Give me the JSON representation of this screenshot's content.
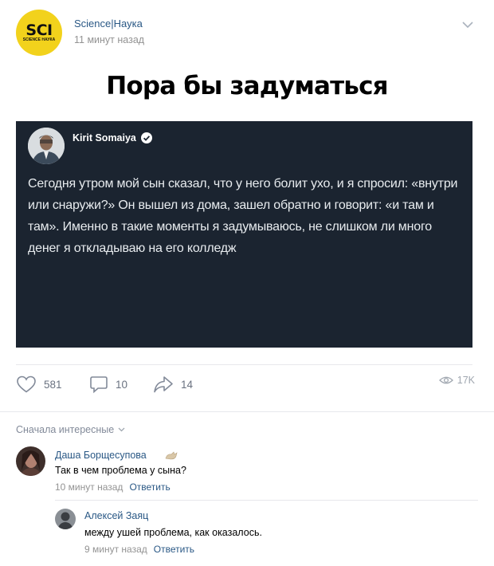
{
  "post": {
    "group_logo_text": "SCI",
    "group_logo_subtext": "SCIENCE НАУКА",
    "group_name": "Science|Наука",
    "time": "11 минут назад"
  },
  "meme": {
    "caption": "Пора бы задуматься",
    "tweet": {
      "author": "Kirit Somaiya",
      "text": "Сегодня утром мой сын сказал, что у него болит ухо, и я спросил: «внутри или снаружи?» Он вышел из дома, зашел обратно и говорит: «и там и там». Именно в такие моменты я задумываюсь, не слишком ли много денег я откладываю на его колледж"
    }
  },
  "actions": {
    "likes": "581",
    "comments": "10",
    "shares": "14",
    "views": "17K"
  },
  "comments_section": {
    "sort_label": "Сначала интересные",
    "items": [
      {
        "author": "Даша Борщесупова",
        "text": "Так в чем проблема у сына?",
        "time": "10 минут назад",
        "reply_label": "Ответить"
      },
      {
        "author": "Алексей Заяц",
        "text": "между ушей проблема, как оказалось.",
        "time": "9 минут назад",
        "reply_label": "Ответить"
      }
    ]
  },
  "colors": {
    "link": "#2a5885",
    "muted": "#939393",
    "tweet_bg": "#1b2430",
    "logo_yellow": "#f2d21c"
  }
}
